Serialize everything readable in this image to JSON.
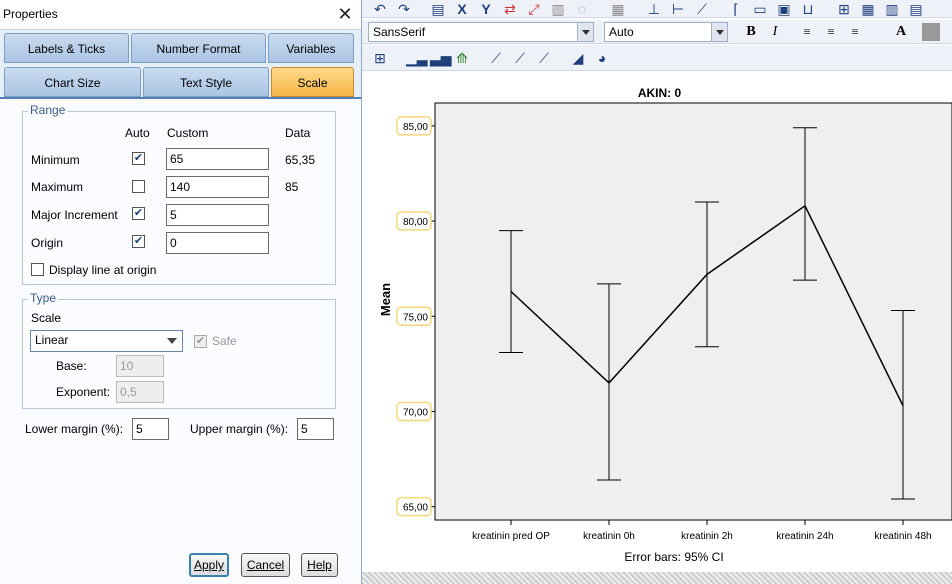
{
  "dialog": {
    "title": "Properties",
    "tabs_row1": [
      "Labels & Ticks",
      "Number Format",
      "Variables"
    ],
    "tabs_row2": [
      "Chart Size",
      "Text Style",
      "Scale"
    ],
    "active_tab": "Scale",
    "range": {
      "legend": "Range",
      "col_auto": "Auto",
      "col_custom": "Custom",
      "col_data": "Data",
      "rows": [
        {
          "label": "Minimum",
          "auto": true,
          "custom": "65",
          "data": "65,35"
        },
        {
          "label": "Maximum",
          "auto": false,
          "custom": "140",
          "data": "85"
        },
        {
          "label": "Major Increment",
          "auto": true,
          "custom": "5",
          "data": ""
        },
        {
          "label": "Origin",
          "auto": true,
          "custom": "0",
          "data": ""
        }
      ],
      "display_line": "Display line at origin",
      "display_line_checked": false
    },
    "type": {
      "legend": "Type",
      "scale_label": "Scale",
      "scale_value": "Linear",
      "safe_label": "Safe",
      "safe_checked": true,
      "base_label": "Base:",
      "base_value": "10",
      "exponent_label": "Exponent:",
      "exponent_value": "0,5"
    },
    "lower_margin_label": "Lower margin (%):",
    "lower_margin_value": "5",
    "upper_margin_label": "Upper margin (%):",
    "upper_margin_value": "5",
    "buttons": {
      "apply": "Apply",
      "cancel": "Cancel",
      "help": "Help"
    }
  },
  "editor": {
    "font_name": "SansSerif",
    "font_size": "Auto",
    "bold": "B",
    "italic": "I"
  },
  "chart_data": {
    "type": "line",
    "title": "AKIN: 0",
    "ylabel": "Mean",
    "xlabel": "Error bars: 95% CI",
    "categories": [
      "kreatinin pred OP",
      "kreatinin 0h",
      "kreatinin 2h",
      "kreatinin 24h",
      "kreatinin 48h"
    ],
    "values": [
      76.3,
      71.5,
      77.2,
      80.8,
      70.3
    ],
    "ci_low": [
      73.1,
      66.4,
      73.4,
      76.9,
      65.4
    ],
    "ci_high": [
      79.5,
      76.7,
      81.0,
      84.9,
      75.3
    ],
    "y_ticks": [
      "65,00",
      "70,00",
      "75,00",
      "80,00",
      "85,00"
    ],
    "ylim": [
      64.3,
      86.2
    ],
    "colors": {
      "plot_bg": "#efefef",
      "line": "#000000",
      "tick_box": "#f3d77a"
    }
  }
}
